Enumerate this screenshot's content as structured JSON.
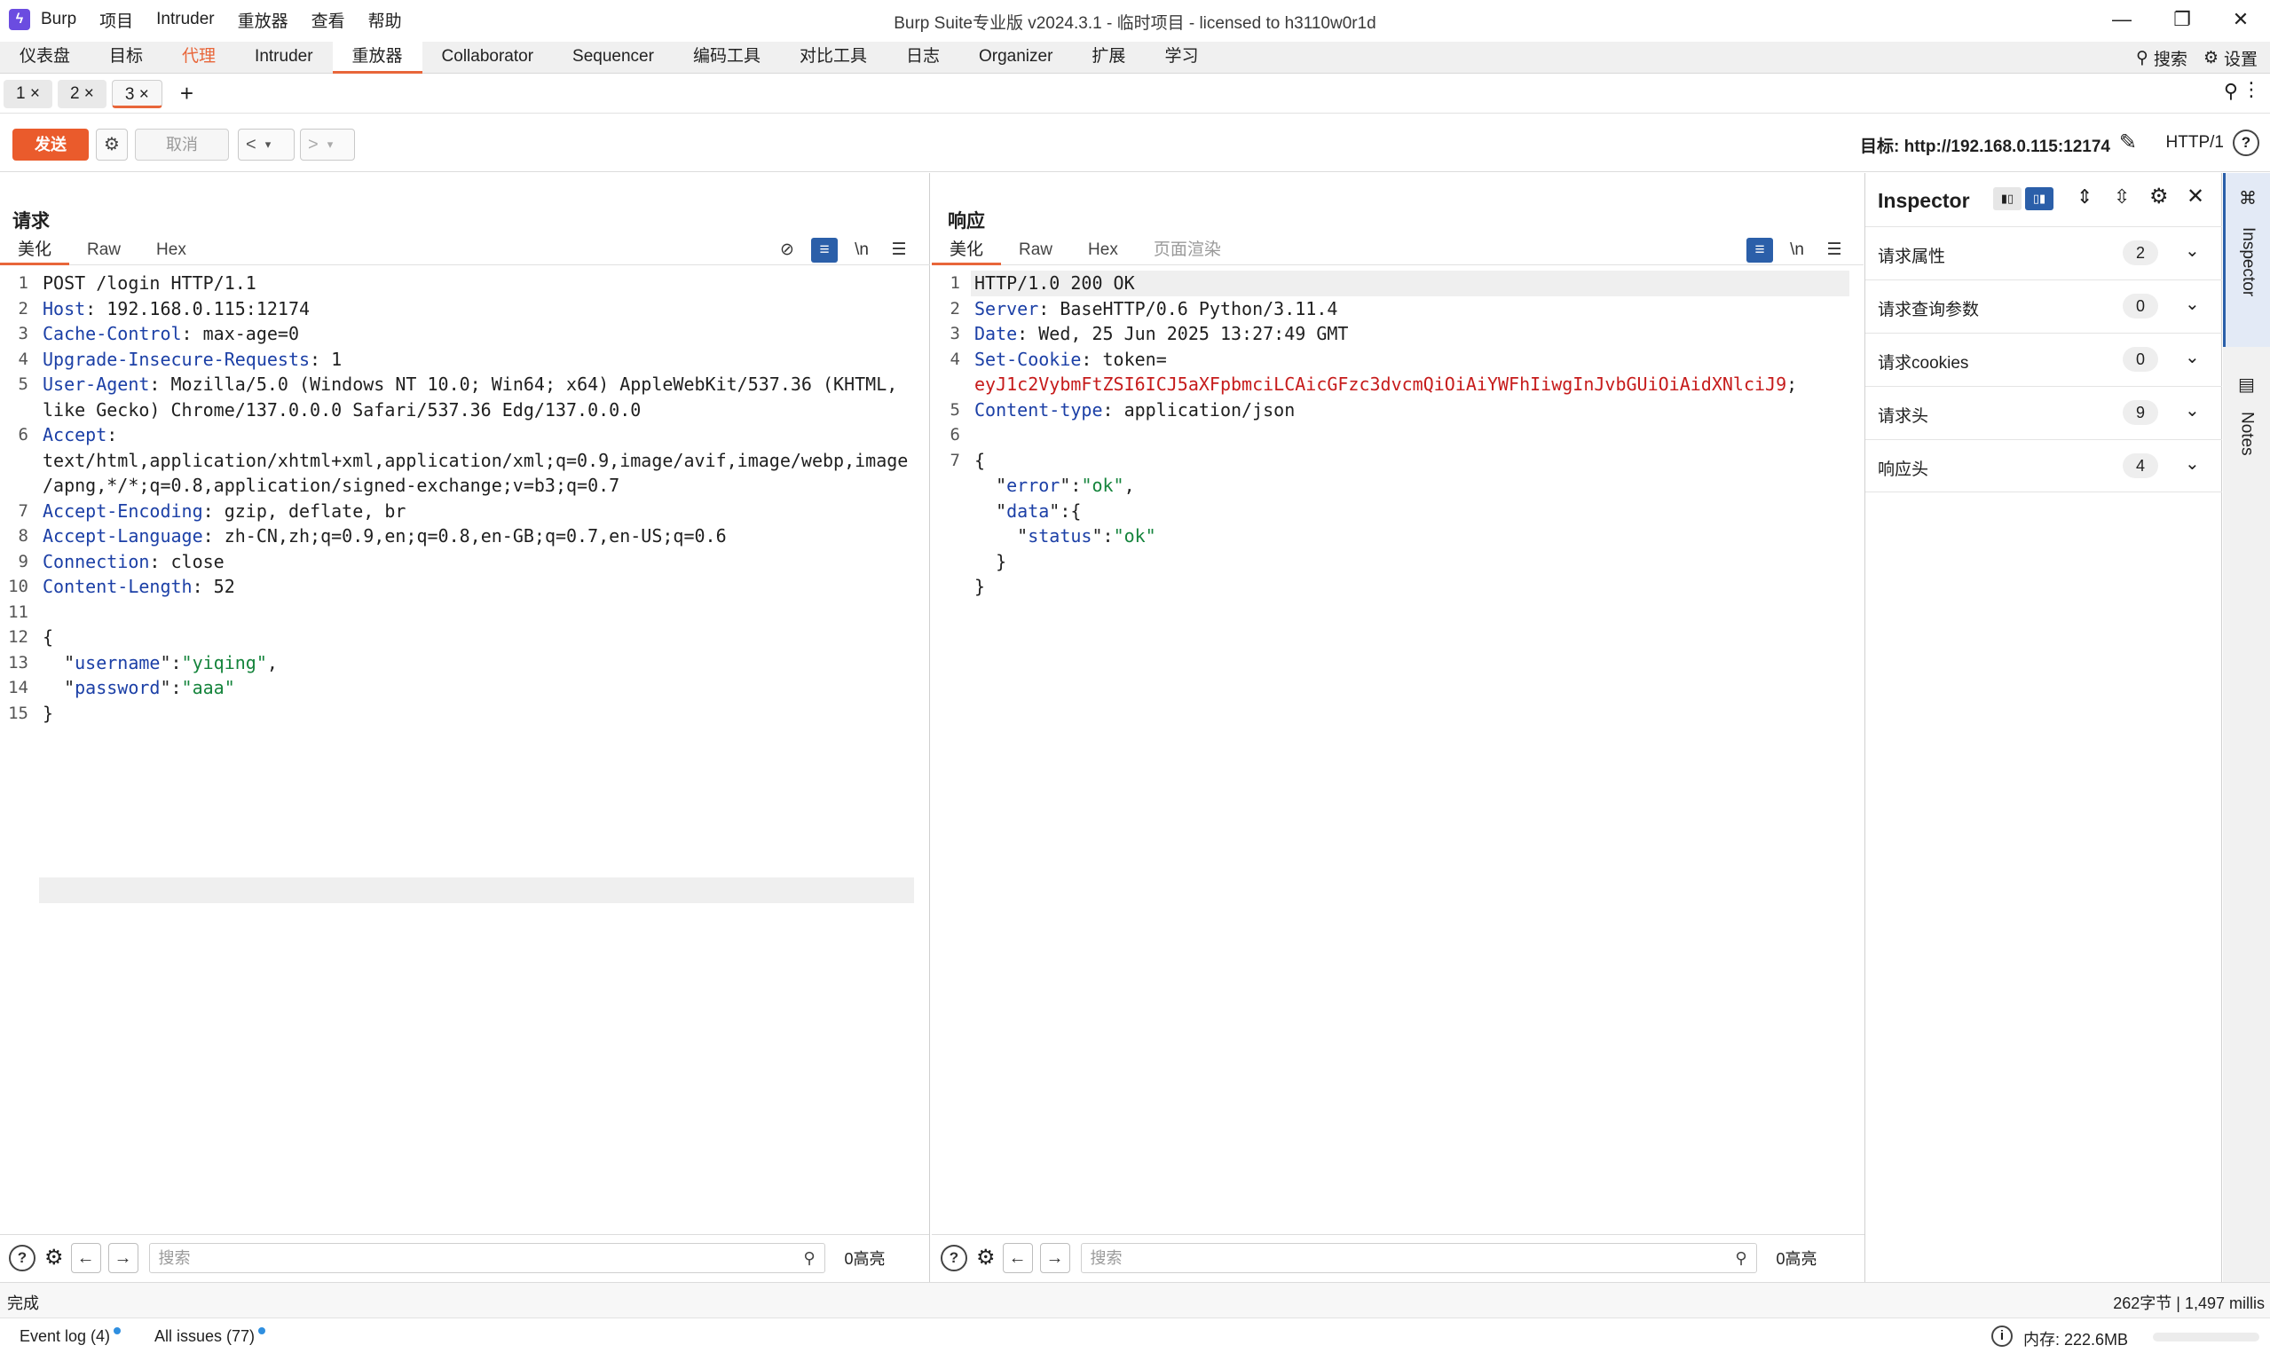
{
  "app": {
    "title": "Burp Suite专业版  v2024.3.1 - 临时项目 - licensed to h3110w0r1d",
    "menu": [
      "Burp",
      "项目",
      "Intruder",
      "重放器",
      "查看",
      "帮助"
    ]
  },
  "main_tabs": [
    "仪表盘",
    "目标",
    "代理",
    "Intruder",
    "重放器",
    "Collaborator",
    "Sequencer",
    "编码工具",
    "对比工具",
    "日志",
    "Organizer",
    "扩展",
    "学习"
  ],
  "main_right": {
    "search": "搜索",
    "settings": "设置"
  },
  "repeater_tabs": [
    "1 ×",
    "2 ×",
    "3 ×"
  ],
  "toolbar": {
    "send": "发送",
    "cancel": "取消",
    "target": "目标: http://192.168.0.115:12174",
    "http_version": "HTTP/1"
  },
  "request": {
    "title": "请求",
    "tabs": [
      "美化",
      "Raw",
      "Hex"
    ],
    "lines": [
      {
        "n": "1",
        "parts": [
          [
            "t",
            "POST /login HTTP/1.1"
          ]
        ]
      },
      {
        "n": "2",
        "parts": [
          [
            "k",
            "Host"
          ],
          [
            "t",
            ": 192.168.0.115:12174"
          ]
        ]
      },
      {
        "n": "3",
        "parts": [
          [
            "k",
            "Cache-Control"
          ],
          [
            "t",
            ": max-age=0"
          ]
        ]
      },
      {
        "n": "4",
        "parts": [
          [
            "k",
            "Upgrade-Insecure-Requests"
          ],
          [
            "t",
            ": 1"
          ]
        ]
      },
      {
        "n": "5",
        "parts": [
          [
            "k",
            "User-Agent"
          ],
          [
            "t",
            ": Mozilla/5.0 (Windows NT 10.0; Win64; x64) AppleWebKit/537.36 (KHTML,"
          ]
        ]
      },
      {
        "n": "",
        "parts": [
          [
            "t",
            "like Gecko) Chrome/137.0.0.0 Safari/537.36 Edg/137.0.0.0"
          ]
        ]
      },
      {
        "n": "6",
        "parts": [
          [
            "k",
            "Accept"
          ],
          [
            "t",
            ":"
          ]
        ]
      },
      {
        "n": "",
        "parts": [
          [
            "t",
            "text/html,application/xhtml+xml,application/xml;q=0.9,image/avif,image/webp,image"
          ]
        ]
      },
      {
        "n": "",
        "parts": [
          [
            "t",
            "/apng,*/*;q=0.8,application/signed-exchange;v=b3;q=0.7"
          ]
        ]
      },
      {
        "n": "7",
        "parts": [
          [
            "k",
            "Accept-Encoding"
          ],
          [
            "t",
            ": gzip, deflate, br"
          ]
        ]
      },
      {
        "n": "8",
        "parts": [
          [
            "k",
            "Accept-Language"
          ],
          [
            "t",
            ": zh-CN,zh;q=0.9,en;q=0.8,en-GB;q=0.7,en-US;q=0.6"
          ]
        ]
      },
      {
        "n": "9",
        "parts": [
          [
            "k",
            "Connection"
          ],
          [
            "t",
            ": close"
          ]
        ]
      },
      {
        "n": "10",
        "parts": [
          [
            "k",
            "Content-Length"
          ],
          [
            "t",
            ": 52"
          ]
        ]
      },
      {
        "n": "11",
        "parts": [
          [
            "t",
            ""
          ]
        ]
      },
      {
        "n": "12",
        "parts": [
          [
            "t",
            "{"
          ]
        ]
      },
      {
        "n": "13",
        "parts": [
          [
            "t",
            "  \""
          ],
          [
            "k",
            "username"
          ],
          [
            "t",
            "\":"
          ],
          [
            "s",
            "\"yiqing\""
          ],
          [
            "t",
            ","
          ]
        ]
      },
      {
        "n": "14",
        "parts": [
          [
            "t",
            "  \""
          ],
          [
            "k",
            "password"
          ],
          [
            "t",
            "\":"
          ],
          [
            "s",
            "\"aaa\""
          ]
        ]
      },
      {
        "n": "15",
        "parts": [
          [
            "t",
            "}"
          ]
        ]
      }
    ],
    "search_placeholder": "搜索",
    "highlight_count": "0高亮"
  },
  "response": {
    "title": "响应",
    "tabs": [
      "美化",
      "Raw",
      "Hex",
      "页面渲染"
    ],
    "lines": [
      {
        "n": "1",
        "parts": [
          [
            "t",
            "HTTP/1.0 200 OK"
          ]
        ]
      },
      {
        "n": "2",
        "parts": [
          [
            "k",
            "Server"
          ],
          [
            "t",
            ": BaseHTTP/0.6 Python/3.11.4"
          ]
        ]
      },
      {
        "n": "3",
        "parts": [
          [
            "k",
            "Date"
          ],
          [
            "t",
            ": Wed, 25 Jun 2025 13:27:49 GMT"
          ]
        ]
      },
      {
        "n": "4",
        "parts": [
          [
            "k",
            "Set-Cookie"
          ],
          [
            "t",
            ": token="
          ]
        ]
      },
      {
        "n": "",
        "parts": [
          [
            "r",
            "eyJ1c2VybmFtZSI6ICJ5aXFpbmciLCAicGFzc3dvcmQiOiAiYWFhIiwgInJvbGUiOiAidXNlciJ9"
          ],
          [
            "t",
            ";"
          ]
        ]
      },
      {
        "n": "5",
        "parts": [
          [
            "k",
            "Content-type"
          ],
          [
            "t",
            ": application/json"
          ]
        ]
      },
      {
        "n": "6",
        "parts": [
          [
            "t",
            ""
          ]
        ]
      },
      {
        "n": "7",
        "parts": [
          [
            "t",
            "{"
          ]
        ]
      },
      {
        "n": "",
        "parts": [
          [
            "t",
            "  \""
          ],
          [
            "k",
            "error"
          ],
          [
            "t",
            "\":"
          ],
          [
            "s",
            "\"ok\""
          ],
          [
            "t",
            ","
          ]
        ]
      },
      {
        "n": "",
        "parts": [
          [
            "t",
            "  \""
          ],
          [
            "k",
            "data"
          ],
          [
            "t",
            "\":{"
          ]
        ]
      },
      {
        "n": "",
        "parts": [
          [
            "t",
            "    \""
          ],
          [
            "k",
            "status"
          ],
          [
            "t",
            "\":"
          ],
          [
            "s",
            "\"ok\""
          ]
        ]
      },
      {
        "n": "",
        "parts": [
          [
            "t",
            "  }"
          ]
        ]
      },
      {
        "n": "",
        "parts": [
          [
            "t",
            "}"
          ]
        ]
      }
    ],
    "search_placeholder": "搜索",
    "highlight_count": "0高亮"
  },
  "inspector": {
    "title": "Inspector",
    "rows": [
      {
        "label": "请求属性",
        "count": "2"
      },
      {
        "label": "请求查询参数",
        "count": "0"
      },
      {
        "label": "请求cookies",
        "count": "0"
      },
      {
        "label": "请求头",
        "count": "9"
      },
      {
        "label": "响应头",
        "count": "4"
      }
    ]
  },
  "sidebar": {
    "inspector": "Inspector",
    "notes": "Notes"
  },
  "status": {
    "left": "完成",
    "right": "262字节 | 1,497 millis"
  },
  "footer": {
    "event_log": "Event log (4)",
    "all_issues": "All issues (77)",
    "memory": "内存: 222.6MB"
  },
  "colors": {
    "accent": "#e8663a",
    "send": "#ea5b2c",
    "key": "#1b3fa6",
    "string": "#15843c",
    "token": "#c61b1b"
  }
}
